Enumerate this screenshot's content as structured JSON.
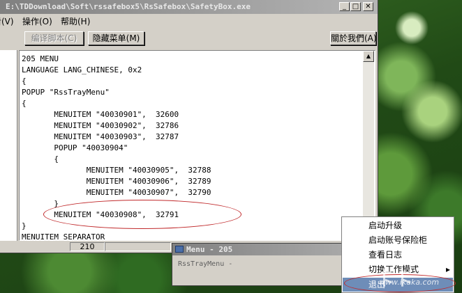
{
  "window": {
    "title": "E:\\TDDownload\\Soft\\rssafebox5\\RsSafebox\\SafetyBox.exe",
    "minimize_glyph": "_",
    "maximize_glyph": "□",
    "close_glyph": "✕"
  },
  "menu_bar": {
    "items": [
      "查看(V)",
      "操作(O)",
      "帮助(H)"
    ]
  },
  "toolbar": {
    "edit_script_label": "编译脚本(C)",
    "hide_menu_label": "隐藏菜单(M)",
    "about_label": "關於我們(A)"
  },
  "editor": {
    "lines": [
      "205 MENU",
      "LANGUAGE LANG_CHINESE, 0x2",
      "{",
      "POPUP \"RssTrayMenu\"",
      "{",
      "       MENUITEM \"40030901\",  32600",
      "       MENUITEM \"40030902\",  32786",
      "       MENUITEM \"40030903\",  32787",
      "       POPUP \"40030904\"",
      "       {",
      "              MENUITEM \"40030905\",  32788",
      "              MENUITEM \"40030906\",  32789",
      "              MENUITEM \"40030907\",  32790",
      "       }",
      "       MENUITEM \"40030908\",  32791",
      "}",
      "MENUITEM SEPARATOR"
    ]
  },
  "status_bar": {
    "position": "210"
  },
  "sub_window": {
    "title": "Menu -    205",
    "content": "RssTrayMenu -"
  },
  "tray_menu": {
    "items": [
      "启动升级",
      "启动账号保险柜",
      "查看日志",
      "切换工作模式",
      "退出"
    ],
    "selected_index": 4,
    "submenu_arrow": "▸"
  },
  "watermark": {
    "text": "卡卡",
    "url": "www.ikaka.com"
  },
  "colors": {
    "highlight_ellipse": "#c0282a",
    "selected_item_bg": "#6e8db8"
  }
}
